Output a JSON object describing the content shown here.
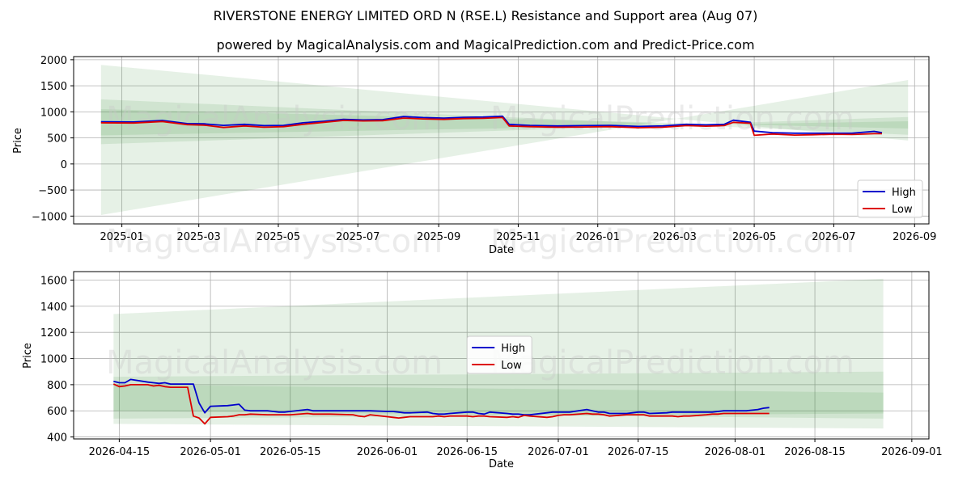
{
  "title": "RIVERSTONE ENERGY LIMITED ORD N (RSE.L) Resistance and Support area (Aug 07)",
  "subtitle": "powered by MagicalAnalysis.com and MagicalPrediction.com and Predict-Price.com",
  "watermark_left": "MagicalAnalysis.com",
  "watermark_right": "MagicalPrediction.com",
  "colors": {
    "high": "#0000cc",
    "low": "#dd0000",
    "band": "#2e8b2e",
    "grid": "#b0b0b0"
  },
  "chart_data": [
    {
      "type": "line",
      "xlabel": "Date",
      "ylabel": "Price",
      "xlim": [
        "2024-11-25",
        "2026-09-12"
      ],
      "ylim": [
        -1150,
        2060
      ],
      "xticks": [
        "2025-01",
        "2025-03",
        "2025-05",
        "2025-07",
        "2025-09",
        "2025-11",
        "2026-01",
        "2026-03",
        "2026-05",
        "2026-07",
        "2026-09"
      ],
      "yticks": [
        -1000,
        -500,
        0,
        500,
        1000,
        1500,
        2000
      ],
      "grid": true,
      "legend": {
        "position": "lower-right",
        "entries": [
          "High",
          "Low"
        ]
      },
      "bands": [
        {
          "x": [
            "2024-12-16",
            "2026-08-27"
          ],
          "upper": [
            1900,
            450
          ],
          "lower": [
            -980,
            1610
          ]
        },
        {
          "x": [
            "2024-12-16",
            "2026-08-27"
          ],
          "upper": [
            1240,
            560
          ],
          "lower": [
            380,
            900
          ]
        },
        {
          "x": [
            "2024-12-16",
            "2026-08-27"
          ],
          "upper": [
            1050,
            680
          ],
          "lower": [
            550,
            820
          ]
        }
      ],
      "series": [
        {
          "name": "High",
          "x": [
            "2024-12-16",
            "2025-01-10",
            "2025-02-01",
            "2025-02-20",
            "2025-03-05",
            "2025-03-20",
            "2025-04-05",
            "2025-04-20",
            "2025-05-05",
            "2025-05-20",
            "2025-06-05",
            "2025-06-20",
            "2025-07-05",
            "2025-07-20",
            "2025-08-05",
            "2025-08-20",
            "2025-09-05",
            "2025-09-20",
            "2025-10-05",
            "2025-10-20",
            "2025-10-25",
            "2025-11-10",
            "2025-12-01",
            "2025-12-20",
            "2026-01-10",
            "2026-02-01",
            "2026-02-20",
            "2026-03-10",
            "2026-03-25",
            "2026-04-08",
            "2026-04-15",
            "2026-04-28",
            "2026-05-01",
            "2026-05-15",
            "2026-06-01",
            "2026-06-15",
            "2026-07-01",
            "2026-07-15",
            "2026-08-01",
            "2026-08-07"
          ],
          "values": [
            810,
            805,
            835,
            775,
            770,
            740,
            760,
            735,
            740,
            790,
            820,
            855,
            845,
            850,
            910,
            890,
            880,
            895,
            900,
            915,
            760,
            740,
            730,
            735,
            740,
            720,
            730,
            760,
            750,
            760,
            840,
            800,
            630,
            600,
            590,
            590,
            590,
            590,
            625,
            600
          ]
        },
        {
          "name": "Low",
          "x": [
            "2024-12-16",
            "2025-01-10",
            "2025-02-01",
            "2025-02-20",
            "2025-03-05",
            "2025-03-20",
            "2025-04-05",
            "2025-04-20",
            "2025-05-05",
            "2025-05-20",
            "2025-06-05",
            "2025-06-20",
            "2025-07-05",
            "2025-07-20",
            "2025-08-05",
            "2025-08-20",
            "2025-09-05",
            "2025-09-20",
            "2025-10-05",
            "2025-10-20",
            "2025-10-25",
            "2025-11-10",
            "2025-12-01",
            "2025-12-20",
            "2026-01-10",
            "2026-02-01",
            "2026-02-20",
            "2026-03-10",
            "2026-03-25",
            "2026-04-08",
            "2026-04-15",
            "2026-04-28",
            "2026-05-01",
            "2026-05-15",
            "2026-06-01",
            "2026-06-15",
            "2026-07-01",
            "2026-07-15",
            "2026-08-01",
            "2026-08-07"
          ],
          "values": [
            790,
            785,
            815,
            755,
            745,
            700,
            730,
            705,
            715,
            760,
            800,
            835,
            825,
            830,
            880,
            865,
            855,
            870,
            875,
            890,
            730,
            715,
            705,
            710,
            715,
            695,
            705,
            735,
            725,
            735,
            800,
            780,
            550,
            575,
            555,
            560,
            570,
            565,
            580,
            580
          ]
        }
      ]
    },
    {
      "type": "line",
      "xlabel": "Date",
      "ylabel": "Price",
      "xlim": [
        "2026-04-07",
        "2026-09-04"
      ],
      "ylim": [
        385,
        1665
      ],
      "xticks": [
        "2026-04-15",
        "2026-05-01",
        "2026-05-15",
        "2026-06-01",
        "2026-06-15",
        "2026-07-01",
        "2026-07-15",
        "2026-08-01",
        "2026-08-15",
        "2026-09-01"
      ],
      "yticks": [
        400,
        600,
        800,
        1000,
        1200,
        1400,
        1600
      ],
      "grid": true,
      "legend": {
        "position": "center",
        "entries": [
          "High",
          "Low"
        ]
      },
      "bands": [
        {
          "x": [
            "2026-04-14",
            "2026-08-27"
          ],
          "upper": [
            1340,
            1610
          ],
          "lower": [
            500,
            465
          ]
        },
        {
          "x": [
            "2026-04-14",
            "2026-08-27"
          ],
          "upper": [
            860,
            900
          ],
          "lower": [
            540,
            580
          ]
        },
        {
          "x": [
            "2026-04-14",
            "2026-08-27"
          ],
          "upper": [
            800,
            740
          ],
          "lower": [
            600,
            540
          ]
        }
      ],
      "series": [
        {
          "name": "High",
          "x": [
            "2026-04-14",
            "2026-04-15",
            "2026-04-16",
            "2026-04-17",
            "2026-04-20",
            "2026-04-21",
            "2026-04-22",
            "2026-04-23",
            "2026-04-24",
            "2026-04-27",
            "2026-04-28",
            "2026-04-29",
            "2026-04-30",
            "2026-05-01",
            "2026-05-04",
            "2026-05-05",
            "2026-05-06",
            "2026-05-07",
            "2026-05-08",
            "2026-05-11",
            "2026-05-12",
            "2026-05-13",
            "2026-05-14",
            "2026-05-15",
            "2026-05-18",
            "2026-05-19",
            "2026-05-20",
            "2026-05-21",
            "2026-05-22",
            "2026-05-26",
            "2026-05-27",
            "2026-05-28",
            "2026-05-29",
            "2026-06-01",
            "2026-06-02",
            "2026-06-03",
            "2026-06-04",
            "2026-06-05",
            "2026-06-08",
            "2026-06-09",
            "2026-06-10",
            "2026-06-11",
            "2026-06-12",
            "2026-06-15",
            "2026-06-16",
            "2026-06-17",
            "2026-06-18",
            "2026-06-19",
            "2026-06-22",
            "2026-06-23",
            "2026-06-24",
            "2026-06-25",
            "2026-06-26",
            "2026-06-29",
            "2026-06-30",
            "2026-07-01",
            "2026-07-02",
            "2026-07-03",
            "2026-07-06",
            "2026-07-07",
            "2026-07-08",
            "2026-07-09",
            "2026-07-10",
            "2026-07-13",
            "2026-07-14",
            "2026-07-15",
            "2026-07-16",
            "2026-07-17",
            "2026-07-20",
            "2026-07-21",
            "2026-07-22",
            "2026-07-23",
            "2026-07-24",
            "2026-07-27",
            "2026-07-28",
            "2026-07-29",
            "2026-07-30",
            "2026-07-31",
            "2026-08-03",
            "2026-08-04",
            "2026-08-05",
            "2026-08-06",
            "2026-08-07"
          ],
          "values": [
            825,
            815,
            815,
            840,
            820,
            815,
            810,
            815,
            805,
            805,
            805,
            660,
            585,
            635,
            640,
            645,
            650,
            605,
            600,
            600,
            595,
            590,
            590,
            595,
            610,
            600,
            600,
            600,
            600,
            600,
            600,
            600,
            600,
            595,
            595,
            590,
            585,
            585,
            590,
            580,
            575,
            575,
            580,
            590,
            590,
            580,
            575,
            590,
            580,
            575,
            575,
            570,
            570,
            585,
            590,
            590,
            590,
            590,
            610,
            600,
            590,
            590,
            580,
            580,
            585,
            590,
            590,
            580,
            585,
            590,
            590,
            590,
            590,
            590,
            590,
            595,
            600,
            600,
            600,
            605,
            610,
            620,
            625
          ]
        },
        {
          "name": "Low",
          "x": [
            "2026-04-14",
            "2026-04-15",
            "2026-04-16",
            "2026-04-17",
            "2026-04-20",
            "2026-04-21",
            "2026-04-22",
            "2026-04-23",
            "2026-04-24",
            "2026-04-27",
            "2026-04-28",
            "2026-04-29",
            "2026-04-30",
            "2026-05-01",
            "2026-05-04",
            "2026-05-05",
            "2026-05-06",
            "2026-05-07",
            "2026-05-08",
            "2026-05-11",
            "2026-05-12",
            "2026-05-13",
            "2026-05-14",
            "2026-05-15",
            "2026-05-18",
            "2026-05-19",
            "2026-05-20",
            "2026-05-21",
            "2026-05-22",
            "2026-05-26",
            "2026-05-27",
            "2026-05-28",
            "2026-05-29",
            "2026-06-01",
            "2026-06-02",
            "2026-06-03",
            "2026-06-04",
            "2026-06-05",
            "2026-06-08",
            "2026-06-09",
            "2026-06-10",
            "2026-06-11",
            "2026-06-12",
            "2026-06-15",
            "2026-06-16",
            "2026-06-17",
            "2026-06-18",
            "2026-06-19",
            "2026-06-22",
            "2026-06-23",
            "2026-06-24",
            "2026-06-25",
            "2026-06-26",
            "2026-06-29",
            "2026-06-30",
            "2026-07-01",
            "2026-07-02",
            "2026-07-03",
            "2026-07-06",
            "2026-07-07",
            "2026-07-08",
            "2026-07-09",
            "2026-07-10",
            "2026-07-13",
            "2026-07-14",
            "2026-07-15",
            "2026-07-16",
            "2026-07-17",
            "2026-07-20",
            "2026-07-21",
            "2026-07-22",
            "2026-07-23",
            "2026-07-24",
            "2026-07-27",
            "2026-07-28",
            "2026-07-29",
            "2026-07-30",
            "2026-07-31",
            "2026-08-03",
            "2026-08-04",
            "2026-08-05",
            "2026-08-06",
            "2026-08-07"
          ],
          "values": [
            805,
            785,
            790,
            800,
            800,
            790,
            795,
            785,
            780,
            780,
            560,
            545,
            500,
            550,
            555,
            560,
            570,
            570,
            575,
            570,
            570,
            570,
            570,
            570,
            580,
            575,
            575,
            575,
            575,
            570,
            560,
            555,
            570,
            555,
            550,
            545,
            550,
            555,
            555,
            555,
            560,
            555,
            560,
            560,
            555,
            560,
            560,
            555,
            550,
            555,
            550,
            565,
            560,
            550,
            555,
            565,
            570,
            570,
            580,
            575,
            575,
            570,
            560,
            570,
            570,
            570,
            570,
            560,
            560,
            560,
            555,
            560,
            560,
            570,
            575,
            575,
            580,
            580,
            580,
            580,
            580,
            580,
            580
          ]
        }
      ]
    }
  ]
}
